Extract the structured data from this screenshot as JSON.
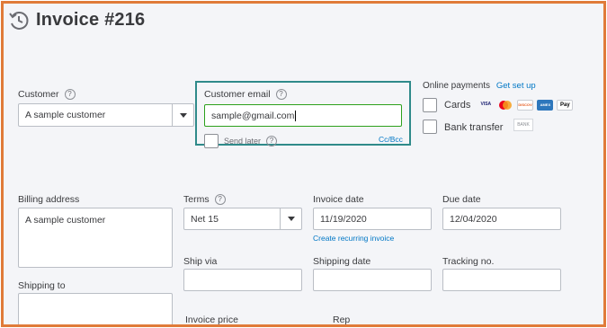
{
  "header": {
    "title": "Invoice #216",
    "icon": "clock-history-icon"
  },
  "customer": {
    "label": "Customer",
    "value": "A sample customer"
  },
  "customer_email": {
    "label": "Customer email",
    "value": "sample@gmail.com",
    "send_later_label": "Send later",
    "cc_bcc": "Cc/Bcc"
  },
  "online_payments": {
    "label": "Online payments",
    "setup_link": "Get set up",
    "cards_label": "Cards",
    "card_brands": [
      "VISA",
      "MC",
      "DISCOVER",
      "AMEX",
      "Pay"
    ],
    "bank_label": "Bank transfer",
    "bank_badge": "BANK"
  },
  "billing": {
    "label": "Billing address",
    "value": "A sample customer"
  },
  "terms": {
    "label": "Terms",
    "value": "Net 15"
  },
  "invoice_date": {
    "label": "Invoice date",
    "value": "11/19/2020",
    "recurring_link": "Create recurring invoice"
  },
  "due_date": {
    "label": "Due date",
    "value": "12/04/2020"
  },
  "ship_via": {
    "label": "Ship via",
    "value": ""
  },
  "shipping_date": {
    "label": "Shipping date",
    "value": ""
  },
  "tracking": {
    "label": "Tracking no.",
    "value": ""
  },
  "shipping_to": {
    "label": "Shipping to",
    "value": ""
  },
  "invoice_price": {
    "label": "Invoice price"
  },
  "rep": {
    "label": "Rep"
  },
  "colors": {
    "frame": "#e07b39",
    "focus_box": "#2f8a8a",
    "input_focus": "#2ca01c",
    "link": "#0077c5"
  }
}
